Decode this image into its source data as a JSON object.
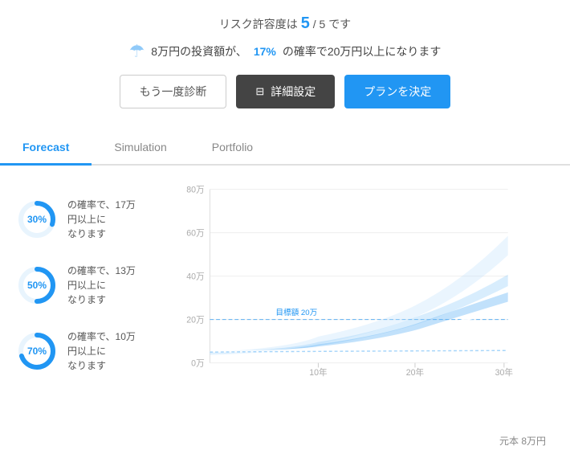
{
  "header": {
    "risk_label": "リスク許容度は",
    "risk_value": "5",
    "risk_max": "5",
    "risk_suffix": "です",
    "subtitle_prefix": "8万円の投資額が、",
    "subtitle_highlight": "17%",
    "subtitle_suffix": "の確率で20万円以上になります"
  },
  "buttons": {
    "retry": "もう一度診断",
    "settings": "詳細設定",
    "decide": "プランを決定"
  },
  "tabs": [
    {
      "id": "forecast",
      "label": "Forecast",
      "active": true
    },
    {
      "id": "simulation",
      "label": "Simulation",
      "active": false
    },
    {
      "id": "portfolio",
      "label": "Portfolio",
      "active": false
    }
  ],
  "legend_items": [
    {
      "pct": "30%",
      "text1": "の確率で、17万円以上に",
      "text2": "なります",
      "value": 30
    },
    {
      "pct": "50%",
      "text1": "の確率で、13万円以上に",
      "text2": "なります",
      "value": 50
    },
    {
      "pct": "70%",
      "text1": "の確率で、10万円以上に",
      "text2": "なります",
      "value": 70
    }
  ],
  "chart": {
    "y_labels": [
      "80万",
      "60万",
      "40万",
      "20万",
      "0万"
    ],
    "x_labels": [
      "10年",
      "20年",
      "30年"
    ],
    "target_label": "目標額 20万",
    "source_label": "元本 8万円"
  }
}
